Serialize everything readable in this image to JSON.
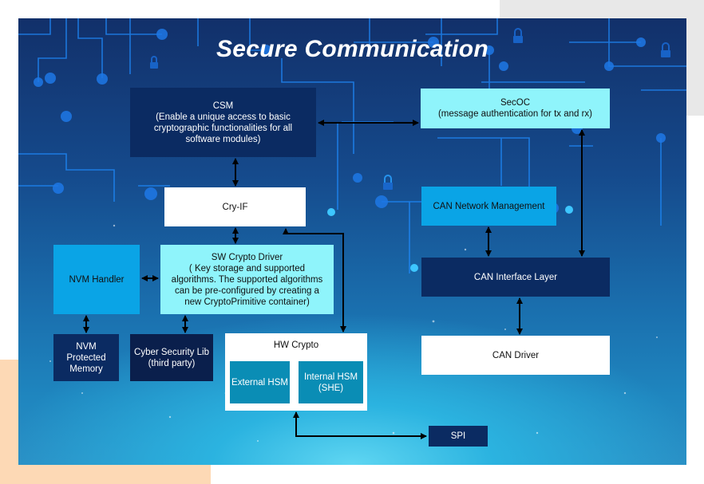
{
  "title": "Secure Communication",
  "boxes": {
    "csm": "CSM\n(Enable a unique access to basic\ncryptographic functionalities for all\nsoftware modules)",
    "secoc": "SecOC\n(message authentication for tx and rx)",
    "cryif": "Cry-IF",
    "can_nm": "CAN Network Management",
    "nvm_handler": "NVM Handler",
    "sw_crypto": "SW Crypto Driver\n( Key storage and supported\nalgorithms. The supported algorithms\ncan be pre-configured by creating a\nnew CryptoPrimitive container)",
    "can_if": "CAN Interface Layer",
    "nvm_mem": "NVM\nProtected\nMemory",
    "cyber_lib": "Cyber Security Lib\n(third party)",
    "hw_crypto": "HW Crypto",
    "ext_hsm": "External HSM",
    "int_hsm": "Internal HSM\n(SHE)",
    "can_driver": "CAN Driver",
    "spi": "SPI"
  },
  "colors": {
    "dark_box": "#0b2b62",
    "light_cyan_box": "#8ff4fb",
    "blue_box": "#0aa4e6",
    "teal_box": "#0a8db5",
    "circuit_line": "#1e9bff"
  }
}
